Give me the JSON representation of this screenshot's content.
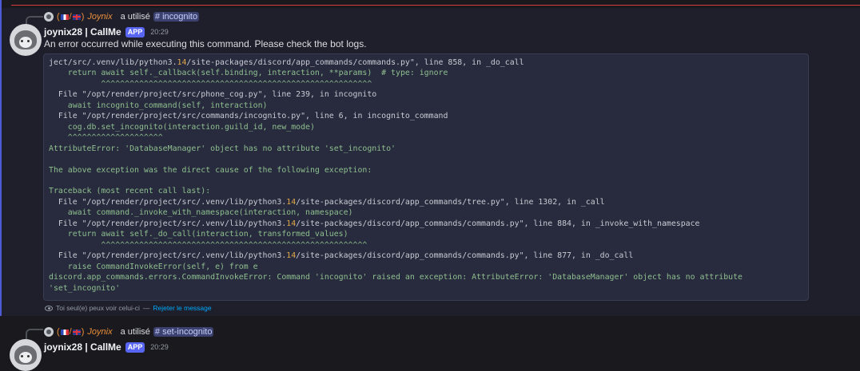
{
  "message1": {
    "reply": {
      "flags_prefix": "(",
      "flags_sep": "/",
      "flags_suffix": ")",
      "name": "Joynix",
      "used_text": "a utilisé",
      "command": "# incognito"
    },
    "username": "joynix28 | CallMe",
    "badge": "APP",
    "timestamp": "20:29",
    "text": "An error occurred while executing this command. Please check the bot logs.",
    "code_lines": [
      {
        "style": "plain",
        "text": "ject/src/.venv/lib/python3.",
        "num": "14",
        "rest": "/site-packages/discord/app_commands/commands.py\", line 858, in _do_call"
      },
      {
        "style": "green",
        "text": "    return await self._callback(self.binding, interaction, **params)  # type: ignore"
      },
      {
        "style": "caret",
        "text": "           ^^^^^^^^^^^^^^^^^^^^^^^^^^^^^^^^^^^^^^^^^^^^^^^^^^^^^^^^^"
      },
      {
        "style": "plain",
        "text": "  File \"/opt/render/project/src/phone_cog.py\", line 239, in incognito"
      },
      {
        "style": "green",
        "text": "    await incognito_command(self, interaction)"
      },
      {
        "style": "plain",
        "text": "  File \"/opt/render/project/src/commands/incognito.py\", line 6, in incognito_command"
      },
      {
        "style": "green",
        "text": "    cog.db.set_incognito(interaction.guild_id, new_mode)"
      },
      {
        "style": "caret",
        "text": "    ^^^^^^^^^^^^^^^^^^^^"
      },
      {
        "style": "green",
        "text": "AttributeError: 'DatabaseManager' object has no attribute 'set_incognito'"
      },
      {
        "style": "green",
        "text": ""
      },
      {
        "style": "green",
        "text": "The above exception was the direct cause of the following exception:"
      },
      {
        "style": "green",
        "text": ""
      },
      {
        "style": "green",
        "text": "Traceback (most recent call last):"
      },
      {
        "style": "plain",
        "text": "  File \"/opt/render/project/src/.venv/lib/python3.",
        "num": "14",
        "rest": "/site-packages/discord/app_commands/tree.py\", line 1302, in _call"
      },
      {
        "style": "green",
        "text": "    await command._invoke_with_namespace(interaction, namespace)"
      },
      {
        "style": "plain",
        "text": "  File \"/opt/render/project/src/.venv/lib/python3.",
        "num": "14",
        "rest": "/site-packages/discord/app_commands/commands.py\", line 884, in _invoke_with_namespace"
      },
      {
        "style": "green",
        "text": "    return await self._do_call(interaction, transformed_values)"
      },
      {
        "style": "caret",
        "text": "           ^^^^^^^^^^^^^^^^^^^^^^^^^^^^^^^^^^^^^^^^^^^^^^^^^^^^^^^^"
      },
      {
        "style": "plain",
        "text": "  File \"/opt/render/project/src/.venv/lib/python3.",
        "num": "14",
        "rest": "/site-packages/discord/app_commands/commands.py\", line 877, in _do_call"
      },
      {
        "style": "green",
        "text": "    raise CommandInvokeError(self, e) from e"
      },
      {
        "style": "green",
        "text": "discord.app_commands.errors.CommandInvokeError: Command 'incognito' raised an exception: AttributeError: 'DatabaseManager' object has no attribute"
      },
      {
        "style": "green",
        "text": "'set_incognito'"
      }
    ],
    "footer": {
      "visibility_text": "Toi seul(e) peux voir celui-ci",
      "separator": "—",
      "dismiss_text": "Rejeter le message"
    }
  },
  "message2": {
    "reply": {
      "flags_prefix": "(",
      "flags_sep": "/",
      "flags_suffix": ")",
      "name": "Joynix",
      "used_text": "a utilisé",
      "command": "# set-incognito"
    },
    "username": "joynix28 | CallMe",
    "badge": "APP",
    "timestamp": "20:29"
  }
}
